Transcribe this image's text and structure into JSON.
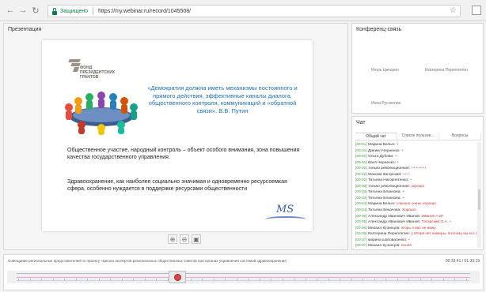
{
  "browser": {
    "secure_label": "Защищено",
    "url": "https://my.webinar.ru/record/1045508/",
    "icons": [
      "back-icon",
      "forward-icon",
      "reload-icon",
      "lock-icon",
      "star-icon",
      "menu-icon"
    ]
  },
  "presentation": {
    "title": "Презентация",
    "slide": {
      "logo_text": "ФОНД\nПРЕЗИДЕНТСКИХ\nГРАНТОВ",
      "quote": "«Демократия должна иметь механизмы постоянного и прямого действия, эффективные каналы диалога, общественного контроля, коммуникаций и «обратной связи». В.В. Путин",
      "paragraph_1": "Общественное участие, народный контроль – объект особого внимания, зона повышения качества государственного управления.",
      "paragraph_2": "Здравоохранение, как наиболее социально значимая и одновременно ресурсоемкая сфера, особенно нуждается в поддержке ресурсами общественности",
      "watermark": "MS"
    },
    "zoom": [
      "zoom-in-icon",
      "zoom-out-icon",
      "save-icon"
    ]
  },
  "conference": {
    "title": "Конференц-связь",
    "participants": [
      "Игорь Цикорин",
      "Екатерина Переплетин",
      "Инна Русскелин"
    ]
  },
  "chat": {
    "title": "Чат",
    "tabs": [
      "Общий чат",
      "Список пользов...",
      "Вопросы"
    ],
    "messages": [
      {
        "time": "[00:01]",
        "name": "Марина Белых:",
        "text": "+"
      },
      {
        "time": "[00:01]",
        "name": "Даниил Черненко:",
        "text": "+"
      },
      {
        "time": "[00:01]",
        "name": "Ольга Дубова:",
        "text": "+"
      },
      {
        "time": "[00:01]",
        "name": "Вася Черненко:",
        "text": "+"
      },
      {
        "time": "[00:02]",
        "name": "только революционная:",
        "text": "+++++++"
      },
      {
        "time": "[00:02]",
        "name": "Максим Загорский:",
        "text": "+++"
      },
      {
        "time": "[00:02]",
        "name": "Татьяна Нагорнятенко:",
        "text": "+"
      },
      {
        "time": "[00:03]",
        "name": "только революционная:",
        "text": "хорошо"
      },
      {
        "time": "[00:03]",
        "name": "Татьяна Бланкова:",
        "text": "+"
      },
      {
        "time": "[00:03]",
        "name": "Татьяна Бланкова:",
        "text": "+"
      },
      {
        "time": "[00:04]",
        "name": "Марина Белых:",
        "text": "слышно очень хорошо"
      },
      {
        "time": "[00:04]",
        "name": "Татьяна Бекачова:",
        "text": "Хорошо"
      },
      {
        "time": "[00:05]",
        "name": "Александр Иванович Иванов:",
        "text": "Иванов А.И+"
      },
      {
        "time": "[00:05]",
        "name": "Александр Иванович Иванов:",
        "text": "Татарский О.А. +"
      },
      {
        "time": "[00:06]",
        "name": "Михаил Кузнецов:",
        "text": "игорь я вас не вижу"
      },
      {
        "time": "[00:06]",
        "name": "Екатерина Переплетин:",
        "text": "у Игоря нет камеры, поэтому вы его не видите"
      },
      {
        "time": "[00:07]",
        "name": "марина шаповаленко:",
        "text": "+"
      },
      {
        "time": "[00:07]",
        "name": "Михаил Кузнецов:",
        "text": "понял"
      }
    ]
  },
  "timeline": {
    "title": "Совещание региональных представителей по проекту «Школа экспертов региональных общественных советов при органах управления системой здравоохранения",
    "time": "00:33:41 / 01:33:19",
    "progress_fraction": 0.36
  }
}
